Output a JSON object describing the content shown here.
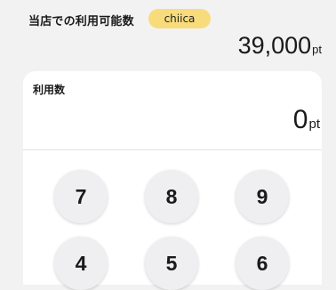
{
  "header": {
    "available_label": "当店での利用可能数",
    "badge": "chiica",
    "balance_value": "39,000",
    "balance_unit": "pt"
  },
  "usage": {
    "label": "利用数",
    "value": "0",
    "unit": "pt"
  },
  "keypad": {
    "keys": [
      "7",
      "8",
      "9",
      "4",
      "5",
      "6"
    ]
  },
  "colors": {
    "badge_bg": "#f8dc7c",
    "page_bg": "#f2f2f3",
    "card_bg": "#ffffff"
  }
}
